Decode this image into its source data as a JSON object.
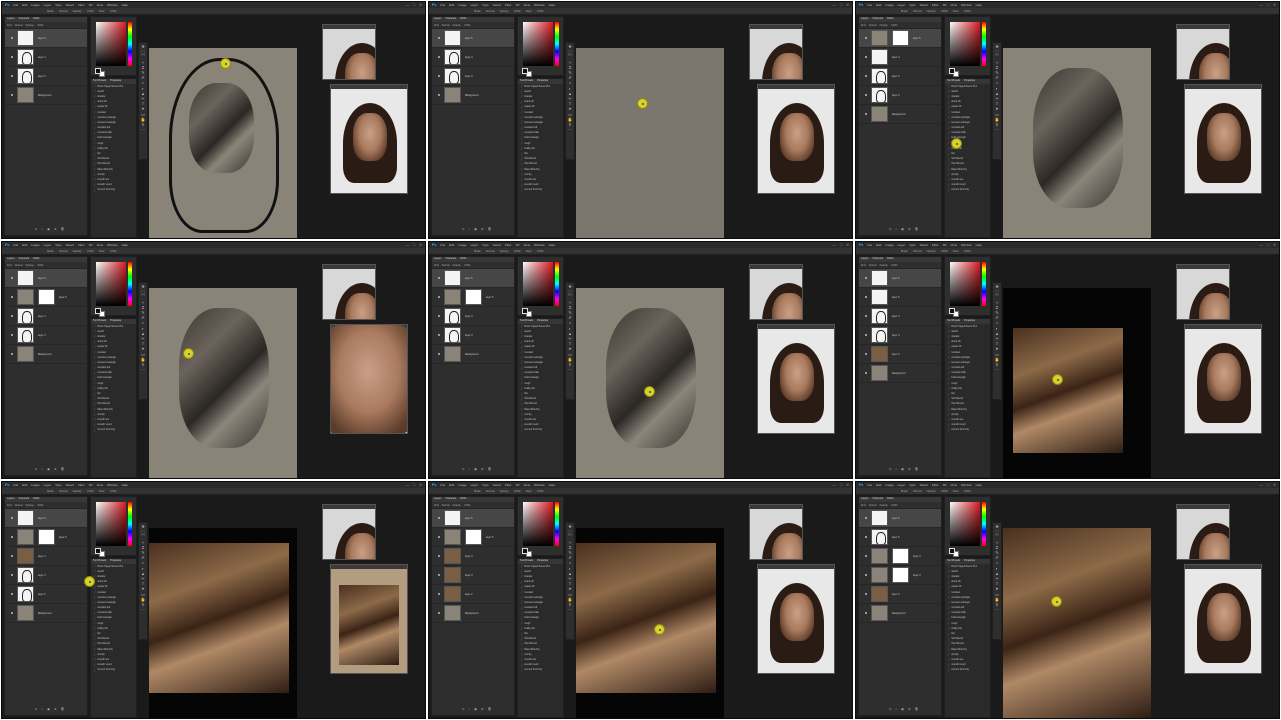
{
  "app": {
    "menu_items": [
      "Ps",
      "File",
      "Edit",
      "Image",
      "Layer",
      "Type",
      "Select",
      "Filter",
      "3D",
      "View",
      "Window",
      "Help"
    ],
    "window_controls": [
      "—",
      "□",
      "✕"
    ],
    "options_bar": [
      "Mode:",
      "Normal",
      "Opacity:",
      "100%",
      "Flow:",
      "100%"
    ],
    "layers_tabs": [
      "Layers",
      "Channels",
      "Paths"
    ],
    "layers_opts": [
      "Kind",
      "Normal",
      "Opacity:",
      "100%"
    ],
    "brush_tabs": [
      "Tool Presets",
      "Properties"
    ]
  },
  "brush_presets": [
    "Brush Tipped Round 36 1",
    "sketch",
    "shadow",
    "sharp nib",
    "square fill",
    "rounded",
    "rounded rectangle",
    "textured rectangle",
    "rounded soft",
    "rounded chalk",
    "bold rectangle",
    "rough",
    "chalky flat",
    "flat",
    "Soft Round",
    "Hard Round",
    "Rake Wide Dry",
    "chunky",
    "smooth wet",
    "smooth round",
    "Current Tool Only"
  ],
  "frames": [
    {
      "name": "frame-1",
      "layers": [
        "layer 5",
        "layer 4",
        "layer 3",
        "Background"
      ],
      "thumbs": [
        "white",
        "sketch",
        "sketch",
        "plain"
      ],
      "canvas": "sketch",
      "cursor": [
        218,
        56
      ],
      "ref_large": "face"
    },
    {
      "name": "frame-2",
      "layers": [
        "layer 5",
        "layer 4",
        "layer 3",
        "Background"
      ],
      "thumbs": [
        "white",
        "sketch",
        "sketch",
        "plain"
      ],
      "canvas": "blank",
      "cursor": [
        208,
        96
      ],
      "ref_large": "face"
    },
    {
      "name": "frame-3",
      "layers": [
        "layer 5",
        "layer 4",
        "layer 3",
        "layer 2",
        "Background"
      ],
      "thumbs": [
        "mask",
        "white",
        "sketch",
        "sketch",
        "plain"
      ],
      "canvas": "gray-face",
      "cursor": [
        95,
        136
      ],
      "ref_large": "face"
    },
    {
      "name": "frame-4",
      "layers": [
        "layer 6",
        "layer 5",
        "layer 4",
        "layer 3",
        "Background"
      ],
      "thumbs": [
        "white",
        "mask",
        "sketch",
        "sketch",
        "plain"
      ],
      "canvas": "gray-face",
      "cursor": [
        181,
        106
      ],
      "ref_large": "closeup"
    },
    {
      "name": "frame-5",
      "layers": [
        "layer 6",
        "layer 5",
        "layer 4",
        "layer 3",
        "Background"
      ],
      "thumbs": [
        "white",
        "mask",
        "sketch",
        "sketch",
        "plain"
      ],
      "canvas": "gray-face",
      "cursor": [
        215,
        144
      ],
      "ref_large": "face"
    },
    {
      "name": "frame-6",
      "layers": [
        "layer 6",
        "layer 5",
        "layer 4",
        "layer 3",
        "layer 2",
        "Background"
      ],
      "thumbs": [
        "white",
        "white",
        "sketch",
        "sketch",
        "warm",
        "plain"
      ],
      "canvas": "seated",
      "cursor": [
        196,
        132
      ],
      "ref_large": "face"
    },
    {
      "name": "frame-7",
      "layers": [
        "layer 6",
        "layer 5",
        "layer 4",
        "layer 3",
        "layer 2",
        "Background"
      ],
      "thumbs": [
        "white",
        "mask",
        "warm",
        "sketch",
        "sketch",
        "plain"
      ],
      "canvas": "warm",
      "cursor": [
        82,
        94
      ],
      "ref_large": "seated"
    },
    {
      "name": "frame-8",
      "layers": [
        "layer 6",
        "layer 5",
        "layer 4",
        "layer 3",
        "layer 2",
        "Background"
      ],
      "thumbs": [
        "white",
        "mask",
        "warm",
        "warm",
        "warm",
        "plain"
      ],
      "canvas": "warm",
      "cursor": [
        225,
        142
      ],
      "ref_large": "face"
    },
    {
      "name": "frame-9",
      "layers": [
        "layer 6",
        "layer 5",
        "layer 4",
        "layer 3",
        "layer 2",
        "Background"
      ],
      "thumbs": [
        "white",
        "sketch",
        "mask",
        "mask",
        "warm",
        "plain"
      ],
      "canvas": "warm-zoom",
      "cursor": [
        195,
        114
      ],
      "ref_large": "face"
    }
  ],
  "colors": {
    "ps_blue": "#31a8ff",
    "panel_bg": "#2e2e2e",
    "canvas_gray": "#8a8378",
    "cursor_yellow": "#d8d22c"
  }
}
